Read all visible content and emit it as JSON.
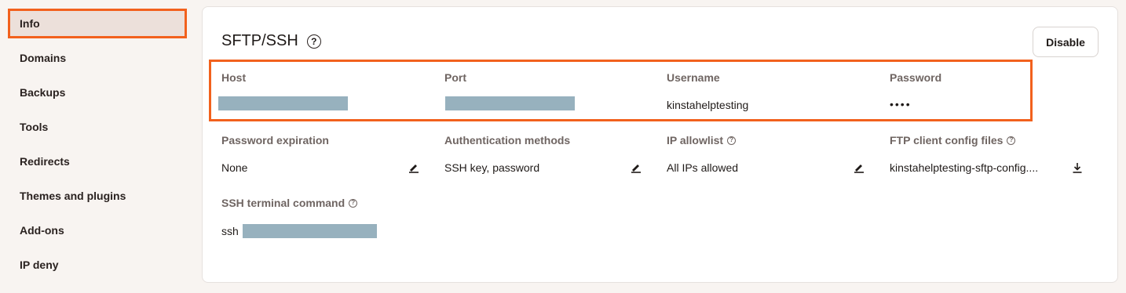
{
  "sidebar": {
    "items": [
      {
        "label": "Info"
      },
      {
        "label": "Domains"
      },
      {
        "label": "Backups"
      },
      {
        "label": "Tools"
      },
      {
        "label": "Redirects"
      },
      {
        "label": "Themes and plugins"
      },
      {
        "label": "Add-ons"
      },
      {
        "label": "IP deny"
      }
    ],
    "active": "Info"
  },
  "panel": {
    "title": "SFTP/SSH",
    "title_help": "?",
    "disable_label": "Disable",
    "host": {
      "label": "Host"
    },
    "port": {
      "label": "Port"
    },
    "username": {
      "label": "Username",
      "value": "kinstahelptesting"
    },
    "password": {
      "label": "Password",
      "value": "••••"
    },
    "password_expiration": {
      "label": "Password expiration",
      "value": "None"
    },
    "auth_methods": {
      "label": "Authentication methods",
      "value": "SSH key, password"
    },
    "ip_allowlist": {
      "label": "IP allowlist",
      "value": "All IPs allowed",
      "help": "?"
    },
    "ftp_config": {
      "label": "FTP client config files",
      "value": "kinstahelptesting-sftp-config....",
      "help": "?"
    },
    "ssh_command": {
      "label": "SSH terminal command",
      "prefix": "ssh",
      "help": "?"
    }
  },
  "colors": {
    "accent": "#f2611d",
    "redaction": "#97b1be",
    "background": "#f8f4f1"
  },
  "icons": [
    "help-icon",
    "edit-icon",
    "download-icon"
  ]
}
